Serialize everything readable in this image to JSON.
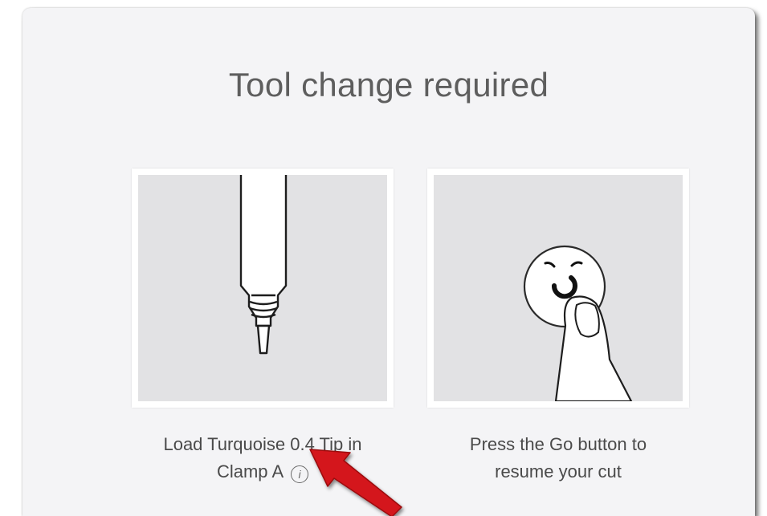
{
  "dialog": {
    "title": "Tool change required"
  },
  "steps": [
    {
      "image_icon": "pen-tip-icon",
      "caption_line1": "Load Turquoise 0.4 Tip in",
      "caption_line2": "Clamp A",
      "info_icon_glyph": "i"
    },
    {
      "image_icon": "go-button-press-icon",
      "caption_line1": "Press the Go button to",
      "caption_line2": "resume your cut"
    }
  ],
  "annotation": {
    "arrow_icon": "red-arrow-icon",
    "arrow_color": "#d4141c"
  },
  "colors": {
    "dialog_background": "#f4f4f6",
    "illustration_background": "#e2e2e4",
    "title_text": "#5e5e5e",
    "caption_text": "#4a4a4a"
  }
}
